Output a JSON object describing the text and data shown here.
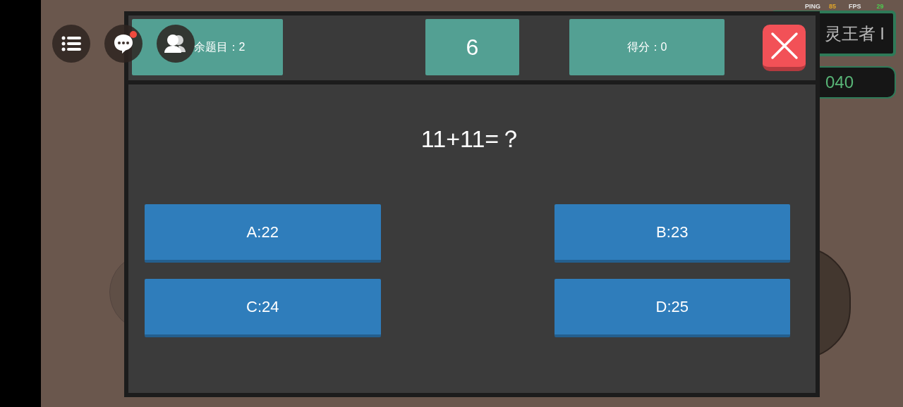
{
  "hud": {
    "ping_label": "PING",
    "ping": "85",
    "fps_label": "FPS",
    "fps": "29",
    "rank": "灵王者 I",
    "score": "040"
  },
  "toolbar": [
    {
      "kind": "menu"
    },
    {
      "kind": "chat",
      "unread": true
    },
    {
      "kind": "friends"
    }
  ],
  "quiz": {
    "remaining": "余题目：2",
    "timer": "6",
    "score": "得分：0",
    "question": "11+11=？",
    "answers": [
      {
        "label": "A:22"
      },
      {
        "label": "B:23"
      },
      {
        "label": "C:24"
      },
      {
        "label": "D:25"
      }
    ]
  }
}
